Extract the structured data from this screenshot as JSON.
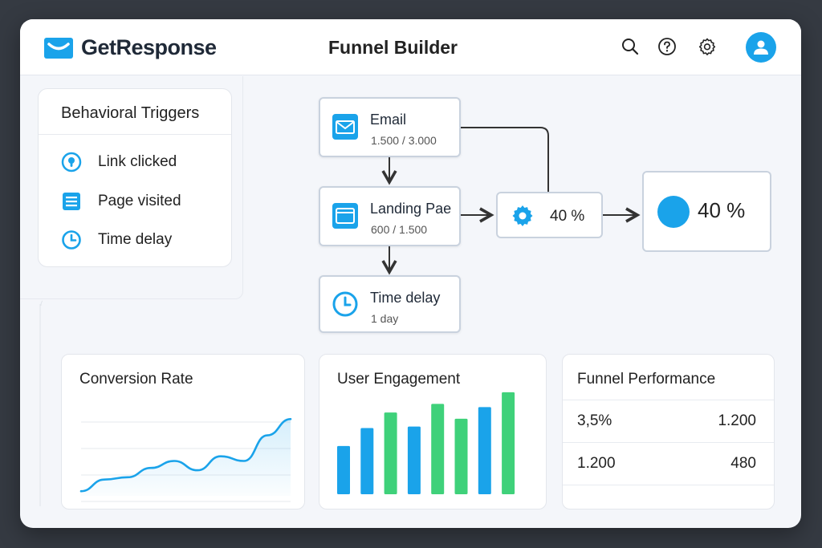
{
  "app": {
    "brand": "GetResponse",
    "page_title": "Funnel Builder"
  },
  "header_icons": [
    "search-icon",
    "help-icon",
    "settings-icon",
    "user-avatar-icon"
  ],
  "colors": {
    "accent": "#1aa3ea",
    "green": "#3fd17a",
    "window_bg": "#f4f6fa",
    "outer_bg": "#353a42"
  },
  "triggers": {
    "title": "Behavioral Triggers",
    "items": [
      {
        "label": "Link clicked",
        "icon": "link-pin-icon"
      },
      {
        "label": "Page visited",
        "icon": "page-list-icon"
      },
      {
        "label": "Time delay",
        "icon": "clock-icon"
      }
    ]
  },
  "flow": {
    "email": {
      "title": "Email",
      "sub": "1.500 / 3.000",
      "icon": "mail-icon"
    },
    "landing": {
      "title": "Landing Pae",
      "sub": "600 / 1.500",
      "icon": "browser-window-icon"
    },
    "delay": {
      "title": "Time delay",
      "sub": "1 day",
      "icon": "clock-icon"
    },
    "gear": {
      "value": "40 %",
      "icon": "gear-icon"
    },
    "result": {
      "value": "40 %"
    }
  },
  "cards": {
    "conversion": {
      "title": "Conversion Rate",
      "chart_data": {
        "type": "area",
        "x": [
          1,
          2,
          3,
          4,
          5,
          6,
          7,
          8,
          9,
          10
        ],
        "values": [
          2,
          7,
          8,
          12,
          15,
          11,
          17,
          15,
          26,
          33
        ],
        "ylim": [
          0,
          40
        ]
      }
    },
    "engagement": {
      "title": "User Engagement",
      "chart_data": {
        "type": "bar",
        "values": [
          62,
          85,
          105,
          87,
          116,
          97,
          112,
          131
        ],
        "colors": [
          "#1aa3ea",
          "#1aa3ea",
          "#3fd17a",
          "#1aa3ea",
          "#3fd17a",
          "#3fd17a",
          "#1aa3ea",
          "#3fd17a"
        ],
        "ylim": [
          0,
          135
        ]
      }
    },
    "performance": {
      "title": "Funnel Performance",
      "rows": [
        {
          "left": "3,5%",
          "right": "1.200"
        },
        {
          "left": "1.200",
          "right": "480"
        }
      ]
    }
  }
}
